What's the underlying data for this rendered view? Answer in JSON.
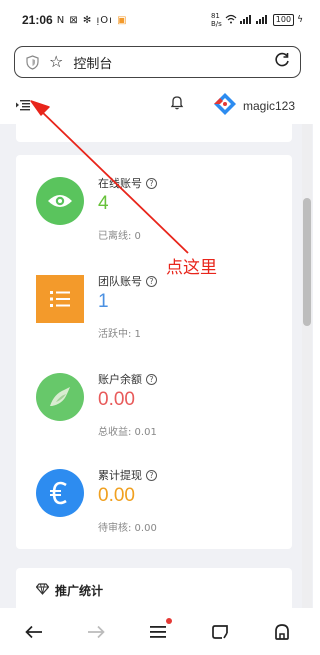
{
  "status_bar": {
    "time": "21:06",
    "notification_icons": "N ⊠ ✻ ı̣Oı",
    "network_speed_top": "81",
    "network_speed_unit": "B/s",
    "signal_text": "⁵ᴳ ⁵ᴳ",
    "battery": "100"
  },
  "browser": {
    "url_text": "控制台",
    "icons": [
      "shield-icon",
      "star-icon",
      "reload-icon"
    ]
  },
  "app_header": {
    "username": "magic123",
    "icons": [
      "menu-toggle-icon",
      "bell-icon",
      "brand-logo-icon"
    ]
  },
  "stats": [
    {
      "label": "在线账号",
      "value": "4",
      "sub": "已离线: 0",
      "value_color": "#67c23a",
      "icon": "eye-icon",
      "icon_bg": "#5ac45d"
    },
    {
      "label": "团队账号",
      "value": "1",
      "sub": "活跃中: 1",
      "value_color": "#4a90e2",
      "icon": "list-icon",
      "icon_bg": "#f39a2b"
    },
    {
      "label": "账户余额",
      "value": "0.00",
      "sub": "总收益: 0.01",
      "value_color": "#e85a5a",
      "icon": "bird-icon",
      "icon_bg": "#67c86a"
    },
    {
      "label": "累计提现",
      "value": "0.00",
      "sub": "待审核: 0.00",
      "value_color": "#f0a020",
      "icon": "euro-icon",
      "icon_bg": "#2d8cf0"
    }
  ],
  "promo": {
    "title": "推广统计",
    "icon": "gem-icon"
  },
  "annotation": {
    "text": "点这里",
    "color": "#e8251b"
  },
  "bottom_nav": {
    "icons": [
      "back-icon",
      "forward-icon",
      "menu-icon",
      "tabs-icon",
      "home-icon"
    ],
    "menu_badge_color": "#e53935"
  }
}
